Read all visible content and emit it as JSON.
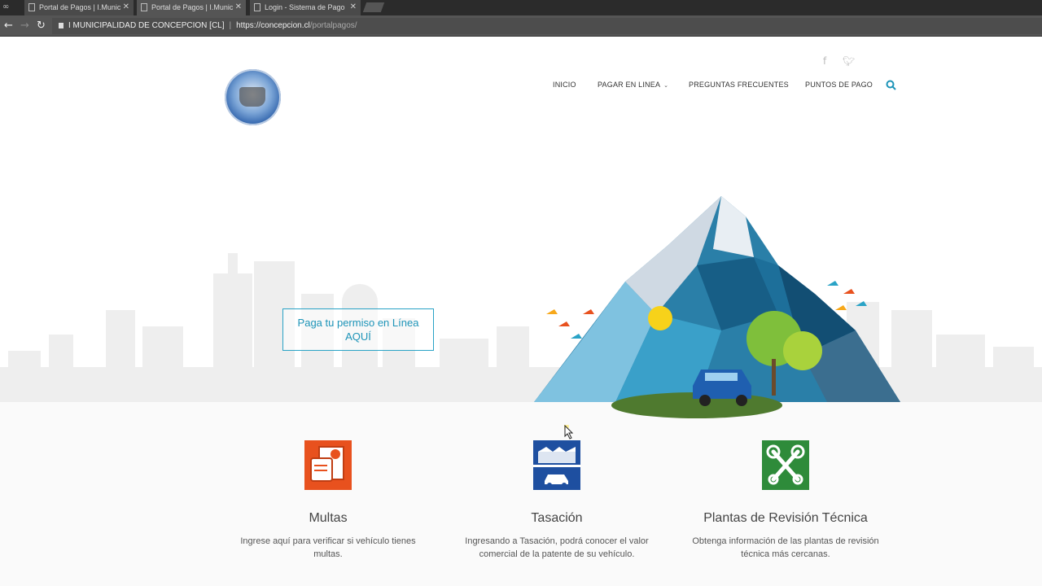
{
  "browser": {
    "tabs": [
      {
        "title": "Portal de Pagos | I.Munic"
      },
      {
        "title": "Portal de Pagos | I.Munic"
      },
      {
        "title": "Login - Sistema de Pago"
      }
    ],
    "site_identity": "I MUNICIPALIDAD DE CONCEPCION [CL]",
    "url_host": "https://concepcion.cl",
    "url_path": "/portalpagos/"
  },
  "header": {
    "social": [
      "facebook-icon",
      "twitter-icon"
    ],
    "menu": [
      {
        "label": "INICIO"
      },
      {
        "label": "PAGAR EN LINEA",
        "has_dropdown": true
      },
      {
        "label": "PREGUNTAS FRECUENTES"
      },
      {
        "label": "PUNTOS DE PAGO"
      }
    ],
    "accent": "#1d94b8"
  },
  "hero": {
    "cta_line1": "Paga tu permiso en Línea",
    "cta_line2": "AQUÍ"
  },
  "features": [
    {
      "icon": "fines-document-icon",
      "title": "Multas",
      "desc": "Ingrese aquí para verificar si vehículo tienes multas.",
      "color": "#e8511e"
    },
    {
      "icon": "car-valuation-icon",
      "title": "Tasación",
      "desc": "Ingresando a Tasación, podrá conocer el valor comercial de la patente de su vehículo.",
      "color": "#1e4fa0"
    },
    {
      "icon": "wrench-tools-icon",
      "title": "Plantas de Revisión Técnica",
      "desc": "Obtenga información de las plantas de revisión técnica más cercanas.",
      "color": "#2e8b3a"
    }
  ]
}
